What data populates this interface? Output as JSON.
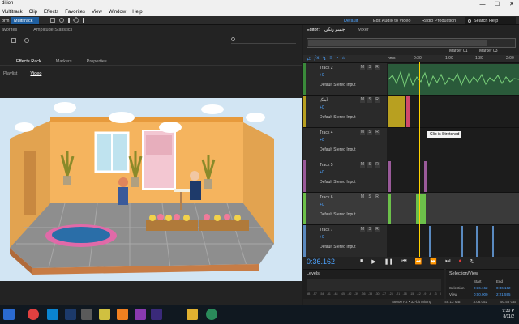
{
  "window": {
    "title": "dition",
    "controls": [
      "—",
      "☐",
      "✕"
    ]
  },
  "menu": [
    "Multitrack",
    "Clip",
    "Effects",
    "Favorites",
    "View",
    "Window",
    "Help"
  ],
  "toolbar": {
    "left_labels": [
      "orm",
      "Multitrack"
    ],
    "workspaces": [
      "Default",
      "Edit Audio to Video",
      "Radio Production"
    ],
    "search_placeholder": "Search Help"
  },
  "left_panel": {
    "tabs_top": [
      "avorites",
      "Amplitude Statistics"
    ],
    "tabs_mid": [
      "Effects Rack",
      "Markers",
      "Properties"
    ],
    "tabs_sub": [
      "Playlist",
      "Video"
    ]
  },
  "editor": {
    "tab_label": "Editor:",
    "tab_file": "جسم رنگی",
    "mixer_tab": "Mixer",
    "ruler_labels": [
      "hms",
      "0:30",
      "1:00",
      "1:30",
      "2:00"
    ],
    "markers": [
      "Marker 01",
      "Marker 03"
    ],
    "tooltip": "Clip is Stretched",
    "timecode": "0:36.162",
    "tracks": [
      {
        "name": "Track 2",
        "input": "Default Stereo Input",
        "volume": "+0",
        "color": "#3a8a3a"
      },
      {
        "name": "آهنگ",
        "input": "Default Stereo Input",
        "volume": "+0",
        "color": "#b8a020"
      },
      {
        "name": "Track 4",
        "input": "Default Stereo Input",
        "volume": "+0",
        "color": "#6a6a6a"
      },
      {
        "name": "Track 5",
        "input": "Default Stereo Input",
        "volume": "+0",
        "color": "#9a5a9a"
      },
      {
        "name": "Track 6",
        "input": "Default Stereo Input",
        "volume": "+0",
        "color": "#6cc04a"
      },
      {
        "name": "Track 7",
        "input": "Default Stereo Input",
        "volume": "+0",
        "color": "#5a8ac0"
      }
    ]
  },
  "levels": {
    "title": "Levels",
    "scale": [
      "dB",
      "-57",
      "-54",
      "-51",
      "-48",
      "-45",
      "-42",
      "-39",
      "-36",
      "-33",
      "-30",
      "-27",
      "-24",
      "-21",
      "-18",
      "-15",
      "-12",
      "-9",
      "-6",
      "-3",
      "0"
    ]
  },
  "selection_view": {
    "title": "Selection/View",
    "headers": [
      "Start",
      "End"
    ],
    "rows": [
      {
        "label": "Selection",
        "start": "0:36.162",
        "end": "0:36.162"
      },
      {
        "label": "View",
        "start": "0:00.000",
        "end": "2:21.595"
      }
    ]
  },
  "status": {
    "sample": "48000 Hz • 32-bit Mixing",
    "size": "49.13 MB",
    "duration": "3:06.052",
    "free": "50.58 GB"
  },
  "taskbar": {
    "time": "9:30 P",
    "date": "8/11/2"
  }
}
